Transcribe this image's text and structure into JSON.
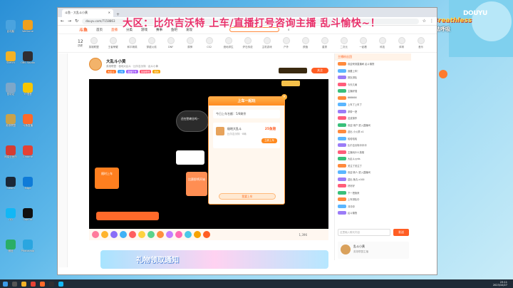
{
  "overlay": {
    "banner": "大区：比尔吉沃特 上车/直播打号咨询主播 乱斗愉快~！",
    "breathless": "Breathless",
    "breathless_sub": "无法呼吸",
    "corner_logo": "DOUYU"
  },
  "desktop_icons": [
    {
      "label": "此电脑",
      "color": "#4aa3df"
    },
    {
      "label": "Sketch",
      "color": "#f3b226"
    },
    {
      "label": "回收站",
      "color": "#7da7c9"
    },
    {
      "label": "英雄联盟",
      "color": "#c9a24a"
    },
    {
      "label": "网易云音乐",
      "color": "#d43c33"
    },
    {
      "label": "Steam",
      "color": "#1b2838"
    },
    {
      "label": "QQ",
      "color": "#12b7f5"
    },
    {
      "label": "微信",
      "color": "#2aae67"
    },
    {
      "label": "WeGame",
      "color": "#f0a01c"
    },
    {
      "label": "OBS Studio",
      "color": "#302e31"
    },
    {
      "label": "YY语音",
      "color": "#f7c600"
    },
    {
      "label": "斗鱼直播",
      "color": "#ff6a2a"
    },
    {
      "label": "Chrome",
      "color": "#e44235"
    },
    {
      "label": "Edge",
      "color": "#0f7bd8"
    },
    {
      "label": "CapCut",
      "color": "#111111"
    },
    {
      "label": "Photoshop",
      "color": "#2aa6e0"
    }
  ],
  "browser": {
    "tab_title": "斗鱼 - 大乱斗小黄",
    "url": "douyu.com/7158863",
    "nav": [
      "首页",
      "直播",
      "分类",
      "游戏",
      "赛事",
      "鱼吧",
      "发现"
    ],
    "logo": "斗鱼",
    "history_count": "12",
    "history_label": "历史",
    "categories": [
      "英雄联盟",
      "王者荣耀",
      "和平精英",
      "穿越火线",
      "DNF",
      "原神",
      "CS2",
      "绝地求生",
      "炉石传说",
      "主机游戏",
      "户外",
      "颜值",
      "星秀",
      "二次元",
      "一起看",
      "科技",
      "体育",
      "音乐"
    ]
  },
  "room": {
    "name": "大乱斗小黄",
    "meta": "英雄联盟 · 极地大乱斗 · 比尔吉沃特 · 乱斗小黄",
    "tags": [
      "大乱斗",
      "上车",
      "直播打号",
      "英雄联盟",
      "陪玩"
    ],
    "viewers": "1,396",
    "follow": "关注"
  },
  "popup": {
    "title": "上车一起玩",
    "subtitle": "今日上车名额：5/8剩余",
    "item_name": "极地大乱斗",
    "item_desc": "比尔吉沃特 · 8局",
    "price": "25鱼翅",
    "button": "立即上车",
    "bottom_button": "我要上车"
  },
  "video_overlays": {
    "bubble": "还在愁峡谷吗~",
    "card": "随时上车",
    "ad": "比赛即将开始"
  },
  "chat": {
    "header": "主播粉丝团",
    "rows": [
      "欢迎来到直播间 乱斗愉快",
      "我要上车！",
      "排队排队",
      "今天几局",
      "主播好强",
      "666666",
      "上车了上车了",
      "求带一把",
      "这波操作",
      "欢迎 用户 进入直播间",
      "送出 小火箭 x1",
      "哈哈哈哈",
      "比尔吉沃特冲冲冲",
      "主播玩什么英雄",
      "大乱斗yyds",
      "关注了关注了",
      "欢迎 新人 进入直播间",
      "送出 鱼丸 x100",
      "好好好",
      "下一把我来",
      "上车排队中",
      "冲冲冲",
      "乱斗愉快"
    ],
    "input_placeholder": "这里输入聊天内容",
    "send": "发送",
    "streamer_label": "乱斗小黄",
    "streamer_desc": "英雄联盟主播"
  },
  "gift_banner": {
    "text": "礼物领取通知"
  },
  "taskbar": {
    "time": "23:11",
    "date": "2023/10/27"
  }
}
